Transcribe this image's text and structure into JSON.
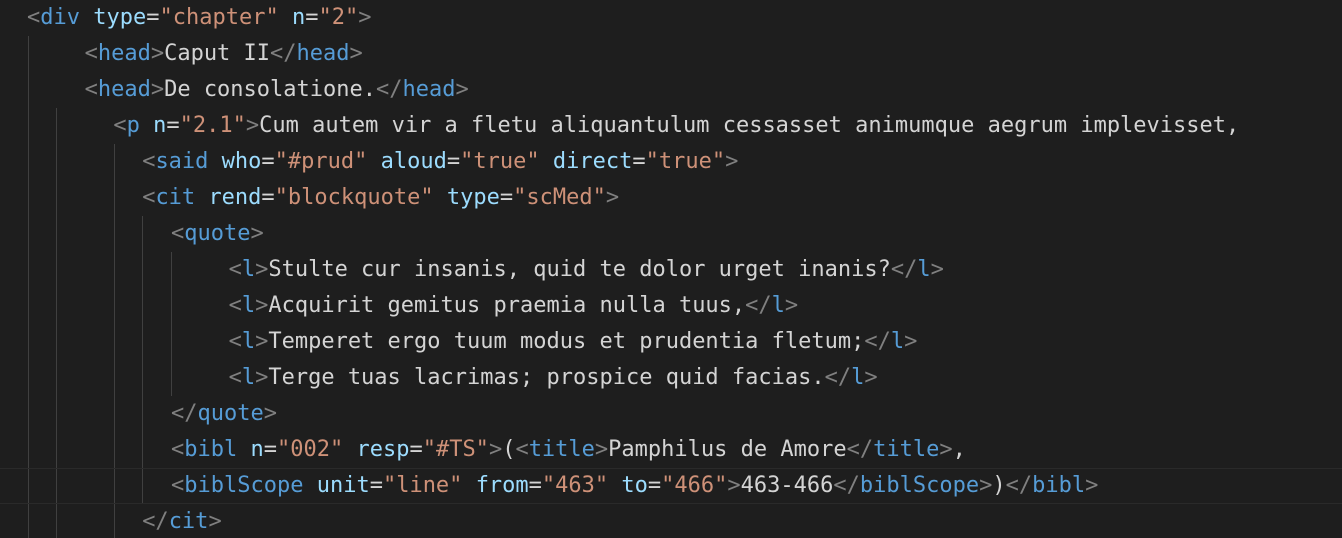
{
  "colors": {
    "background": "#1e1e1e",
    "punctuation": "#808080",
    "tag": "#569cd6",
    "attribute": "#9cdcfe",
    "value": "#ce9178",
    "text": "#d4d4d4",
    "indent_guide": "#404040"
  },
  "lines": [
    {
      "indent": 0,
      "guides": 0,
      "tokens": [
        {
          "k": "p",
          "s": "<"
        },
        {
          "k": "t",
          "s": "div"
        },
        {
          "k": "x",
          "s": " "
        },
        {
          "k": "a",
          "s": "type"
        },
        {
          "k": "eq",
          "s": "="
        },
        {
          "k": "v",
          "s": "\"chapter\""
        },
        {
          "k": "x",
          "s": " "
        },
        {
          "k": "a",
          "s": "n"
        },
        {
          "k": "eq",
          "s": "="
        },
        {
          "k": "v",
          "s": "\"2\""
        },
        {
          "k": "p",
          "s": ">"
        }
      ]
    },
    {
      "indent": 2,
      "guides": 1,
      "tokens": [
        {
          "k": "p",
          "s": "<"
        },
        {
          "k": "t",
          "s": "head"
        },
        {
          "k": "p",
          "s": ">"
        },
        {
          "k": "x",
          "s": "Caput II"
        },
        {
          "k": "p",
          "s": "</"
        },
        {
          "k": "t",
          "s": "head"
        },
        {
          "k": "p",
          "s": ">"
        }
      ]
    },
    {
      "indent": 2,
      "guides": 1,
      "tokens": [
        {
          "k": "p",
          "s": "<"
        },
        {
          "k": "t",
          "s": "head"
        },
        {
          "k": "p",
          "s": ">"
        },
        {
          "k": "x",
          "s": "De consolatione."
        },
        {
          "k": "p",
          "s": "</"
        },
        {
          "k": "t",
          "s": "head"
        },
        {
          "k": "p",
          "s": ">"
        }
      ]
    },
    {
      "indent": 3,
      "guides": 2,
      "tokens": [
        {
          "k": "p",
          "s": "<"
        },
        {
          "k": "t",
          "s": "p"
        },
        {
          "k": "x",
          "s": " "
        },
        {
          "k": "a",
          "s": "n"
        },
        {
          "k": "eq",
          "s": "="
        },
        {
          "k": "v",
          "s": "\"2.1\""
        },
        {
          "k": "p",
          "s": ">"
        },
        {
          "k": "x",
          "s": "Cum autem vir a fletu aliquantulum cessasset animumque aegrum implevisset,"
        }
      ]
    },
    {
      "indent": 4,
      "guides": 3,
      "tokens": [
        {
          "k": "p",
          "s": "<"
        },
        {
          "k": "t",
          "s": "said"
        },
        {
          "k": "x",
          "s": " "
        },
        {
          "k": "a",
          "s": "who"
        },
        {
          "k": "eq",
          "s": "="
        },
        {
          "k": "v",
          "s": "\"#prud\""
        },
        {
          "k": "x",
          "s": " "
        },
        {
          "k": "a",
          "s": "aloud"
        },
        {
          "k": "eq",
          "s": "="
        },
        {
          "k": "v",
          "s": "\"true\""
        },
        {
          "k": "x",
          "s": " "
        },
        {
          "k": "a",
          "s": "direct"
        },
        {
          "k": "eq",
          "s": "="
        },
        {
          "k": "v",
          "s": "\"true\""
        },
        {
          "k": "p",
          "s": ">"
        }
      ]
    },
    {
      "indent": 4,
      "guides": 3,
      "tokens": [
        {
          "k": "p",
          "s": "<"
        },
        {
          "k": "t",
          "s": "cit"
        },
        {
          "k": "x",
          "s": " "
        },
        {
          "k": "a",
          "s": "rend"
        },
        {
          "k": "eq",
          "s": "="
        },
        {
          "k": "v",
          "s": "\"blockquote\""
        },
        {
          "k": "x",
          "s": " "
        },
        {
          "k": "a",
          "s": "type"
        },
        {
          "k": "eq",
          "s": "="
        },
        {
          "k": "v",
          "s": "\"scMed\""
        },
        {
          "k": "p",
          "s": ">"
        }
      ]
    },
    {
      "indent": 5,
      "guides": 4,
      "tokens": [
        {
          "k": "p",
          "s": "<"
        },
        {
          "k": "t",
          "s": "quote"
        },
        {
          "k": "p",
          "s": ">"
        }
      ]
    },
    {
      "indent": 7,
      "guides": 5,
      "tokens": [
        {
          "k": "p",
          "s": "<"
        },
        {
          "k": "t",
          "s": "l"
        },
        {
          "k": "p",
          "s": ">"
        },
        {
          "k": "x",
          "s": "Stulte cur insanis, quid te dolor urget inanis?"
        },
        {
          "k": "p",
          "s": "</"
        },
        {
          "k": "t",
          "s": "l"
        },
        {
          "k": "p",
          "s": ">"
        }
      ]
    },
    {
      "indent": 7,
      "guides": 5,
      "tokens": [
        {
          "k": "p",
          "s": "<"
        },
        {
          "k": "t",
          "s": "l"
        },
        {
          "k": "p",
          "s": ">"
        },
        {
          "k": "x",
          "s": "Acquirit gemitus praemia nulla tuus,"
        },
        {
          "k": "p",
          "s": "</"
        },
        {
          "k": "t",
          "s": "l"
        },
        {
          "k": "p",
          "s": ">"
        }
      ]
    },
    {
      "indent": 7,
      "guides": 5,
      "tokens": [
        {
          "k": "p",
          "s": "<"
        },
        {
          "k": "t",
          "s": "l"
        },
        {
          "k": "p",
          "s": ">"
        },
        {
          "k": "x",
          "s": "Temperet ergo tuum modus et prudentia fletum;"
        },
        {
          "k": "p",
          "s": "</"
        },
        {
          "k": "t",
          "s": "l"
        },
        {
          "k": "p",
          "s": ">"
        }
      ]
    },
    {
      "indent": 7,
      "guides": 5,
      "tokens": [
        {
          "k": "p",
          "s": "<"
        },
        {
          "k": "t",
          "s": "l"
        },
        {
          "k": "p",
          "s": ">"
        },
        {
          "k": "x",
          "s": "Terge tuas lacrimas; prospice quid facias."
        },
        {
          "k": "p",
          "s": "</"
        },
        {
          "k": "t",
          "s": "l"
        },
        {
          "k": "p",
          "s": ">"
        }
      ]
    },
    {
      "indent": 5,
      "guides": 4,
      "tokens": [
        {
          "k": "p",
          "s": "</"
        },
        {
          "k": "t",
          "s": "quote"
        },
        {
          "k": "p",
          "s": ">"
        }
      ]
    },
    {
      "indent": 5,
      "guides": 4,
      "tokens": [
        {
          "k": "p",
          "s": "<"
        },
        {
          "k": "t",
          "s": "bibl"
        },
        {
          "k": "x",
          "s": " "
        },
        {
          "k": "a",
          "s": "n"
        },
        {
          "k": "eq",
          "s": "="
        },
        {
          "k": "v",
          "s": "\"002\""
        },
        {
          "k": "x",
          "s": " "
        },
        {
          "k": "a",
          "s": "resp"
        },
        {
          "k": "eq",
          "s": "="
        },
        {
          "k": "v",
          "s": "\"#TS\""
        },
        {
          "k": "p",
          "s": ">"
        },
        {
          "k": "x",
          "s": "("
        },
        {
          "k": "p",
          "s": "<"
        },
        {
          "k": "t",
          "s": "title"
        },
        {
          "k": "p",
          "s": ">"
        },
        {
          "k": "x",
          "s": "Pamphilus de Amore"
        },
        {
          "k": "p",
          "s": "</"
        },
        {
          "k": "t",
          "s": "title"
        },
        {
          "k": "p",
          "s": ">"
        },
        {
          "k": "x",
          "s": ","
        }
      ]
    },
    {
      "indent": 5,
      "guides": 4,
      "current": true,
      "tokens": [
        {
          "k": "p",
          "s": "<"
        },
        {
          "k": "t",
          "s": "biblScope"
        },
        {
          "k": "x",
          "s": " "
        },
        {
          "k": "a",
          "s": "unit"
        },
        {
          "k": "eq",
          "s": "="
        },
        {
          "k": "v",
          "s": "\"line\""
        },
        {
          "k": "x",
          "s": " "
        },
        {
          "k": "a",
          "s": "from"
        },
        {
          "k": "eq",
          "s": "="
        },
        {
          "k": "v",
          "s": "\"463\""
        },
        {
          "k": "x",
          "s": " "
        },
        {
          "k": "a",
          "s": "to"
        },
        {
          "k": "eq",
          "s": "="
        },
        {
          "k": "v",
          "s": "\"466\""
        },
        {
          "k": "p",
          "s": ">"
        },
        {
          "k": "x",
          "s": "463-466"
        },
        {
          "k": "p",
          "s": "</"
        },
        {
          "k": "t",
          "s": "biblScope"
        },
        {
          "k": "p",
          "s": ">"
        },
        {
          "k": "x",
          "s": ")"
        },
        {
          "k": "p",
          "s": "</"
        },
        {
          "k": "t",
          "s": "bibl"
        },
        {
          "k": "p",
          "s": ">"
        }
      ]
    },
    {
      "indent": 4,
      "guides": 3,
      "tokens": [
        {
          "k": "p",
          "s": "</"
        },
        {
          "k": "t",
          "s": "cit"
        },
        {
          "k": "p",
          "s": ">"
        }
      ]
    }
  ]
}
